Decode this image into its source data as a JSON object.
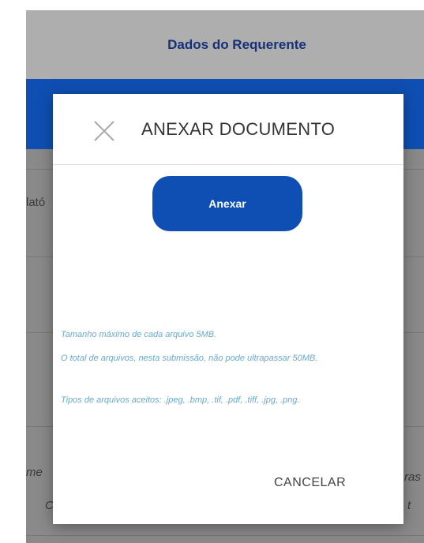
{
  "page": {
    "header_title": "Dados do Requerente",
    "side_left_1": "lató",
    "side_left_2": "me",
    "side_left_3": "C",
    "side_right_1": "ras",
    "side_right_2": "t"
  },
  "modal": {
    "title": "ANEXAR DOCUMENTO",
    "close_icon": "close-icon",
    "attach_label": "Anexar",
    "info": [
      "Tamanho máximo de cada arquivo 5MB.",
      "O total de arquivos, nesta submissão, não pode ultrapassar 50MB.",
      "Tipos de arquivos aceitos: .jpeg, .bmp, .tif, .pdf, .tiff, .jpg, .png."
    ],
    "cancel_label": "CANCELAR"
  },
  "colors": {
    "brand_blue": "#0f4fb3",
    "title_blue": "#16307a",
    "info_text": "#6aa9cf"
  }
}
